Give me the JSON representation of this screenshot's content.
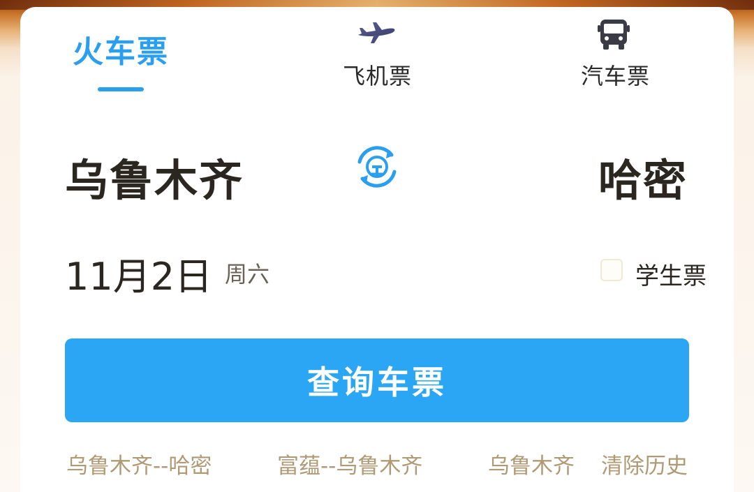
{
  "tabs": {
    "train": {
      "label": "火车票",
      "active": true
    },
    "plane": {
      "label": "飞机票",
      "icon": "airplane-icon"
    },
    "bus": {
      "label": "汽车票",
      "icon": "bus-icon"
    }
  },
  "route": {
    "from": "乌鲁木齐",
    "to": "哈密",
    "swap_icon": "railway-swap-icon"
  },
  "date": {
    "value": "11月2日",
    "weekday": "周六"
  },
  "student_ticket": {
    "label": "学生票",
    "checked": false
  },
  "search_button": {
    "label": "查询车票"
  },
  "history": {
    "items": [
      "乌鲁木齐--哈密",
      "富蕴--乌鲁木齐",
      "乌鲁木齐"
    ],
    "clear_label": "清除历史"
  },
  "colors": {
    "accent": "#2aa6f5",
    "tab_active": "#2a9fef",
    "history_text": "#b09a75",
    "primary_text": "#2b2620"
  }
}
